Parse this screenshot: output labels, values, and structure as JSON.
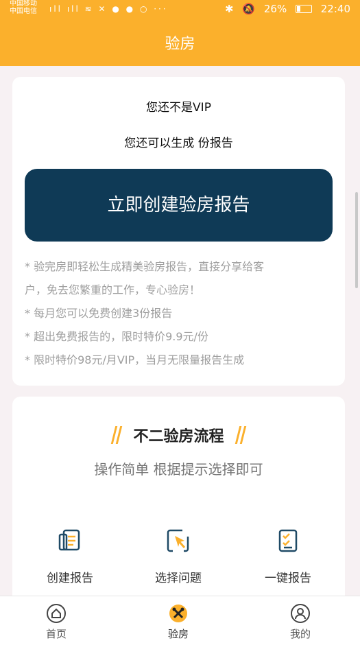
{
  "statusbar": {
    "carrier1": "中国移动",
    "carrier2": "中国电信",
    "icons_left": "ıll ıll ≋ ✕ ●  ● ○ ··· ",
    "battery_pct": "26%",
    "time": "22:40"
  },
  "header": {
    "title": "验房"
  },
  "card1": {
    "vip_status": "您还不是VIP",
    "remaining": "您还可以生成 份报告",
    "create_button": "立即创建验房报告",
    "notes": [
      "* 验完房即轻松生成精美验房报告，直接分享给客",
      "户，免去您繁重的工作，专心验房！",
      "* 每月您可以免费创建3份报告",
      "* 超出免费报告的，限时特价9.9元/份",
      "* 限时特价98元/月VIP，当月无限量报告生成"
    ]
  },
  "card2": {
    "title": "不二验房流程",
    "subtitle": "操作简单 根据提示选择即可",
    "steps": [
      {
        "label": "创建报告",
        "icon": "document-icon"
      },
      {
        "label": "选择问题",
        "icon": "cursor-select-icon"
      },
      {
        "label": "一键报告",
        "icon": "checklist-icon"
      }
    ]
  },
  "tabbar": {
    "items": [
      {
        "label": "首页",
        "icon": "home-icon"
      },
      {
        "label": "验房",
        "icon": "tools-icon",
        "active": true
      },
      {
        "label": "我的",
        "icon": "user-icon"
      }
    ]
  },
  "colors": {
    "accent": "#fbb02c",
    "primary_button": "#0f3a56"
  }
}
